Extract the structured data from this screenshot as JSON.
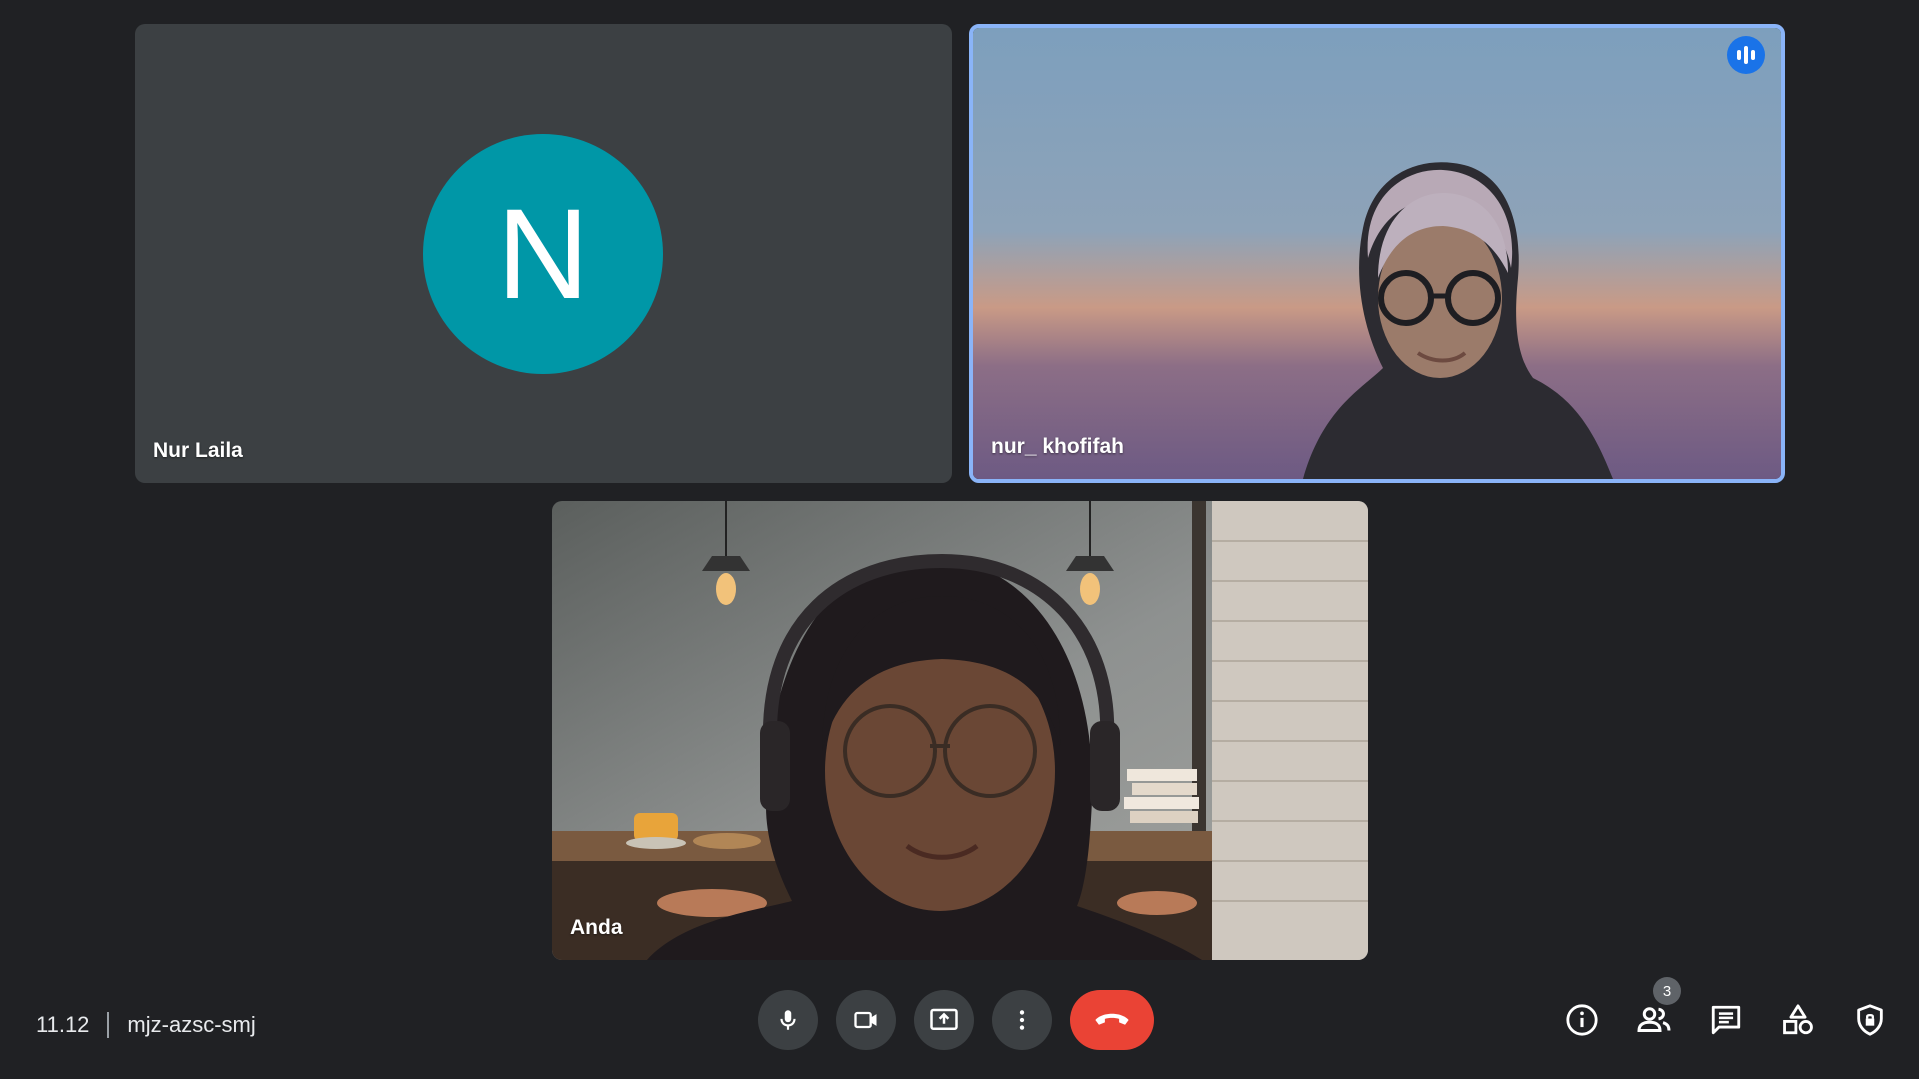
{
  "participants": [
    {
      "name": "Nur Laila",
      "avatar_letter": "N",
      "avatar_color": "#0097a7",
      "camera": "off"
    },
    {
      "name": "nur_ khofifah",
      "camera": "on",
      "speaking": true,
      "highlight_color": "#8ab4f8"
    },
    {
      "name": "Anda",
      "camera": "on"
    }
  ],
  "meeting": {
    "time": "11.12",
    "code": "mjz-azsc-smj"
  },
  "controls": {
    "center": [
      "mic-icon",
      "camera-icon",
      "present-screen-icon",
      "more-options-icon",
      "end-call-icon"
    ],
    "end_call_color": "#ea4335",
    "right": [
      "info-icon",
      "people-icon",
      "chat-icon",
      "activities-icon",
      "host-controls-icon"
    ],
    "people_count": "3"
  }
}
